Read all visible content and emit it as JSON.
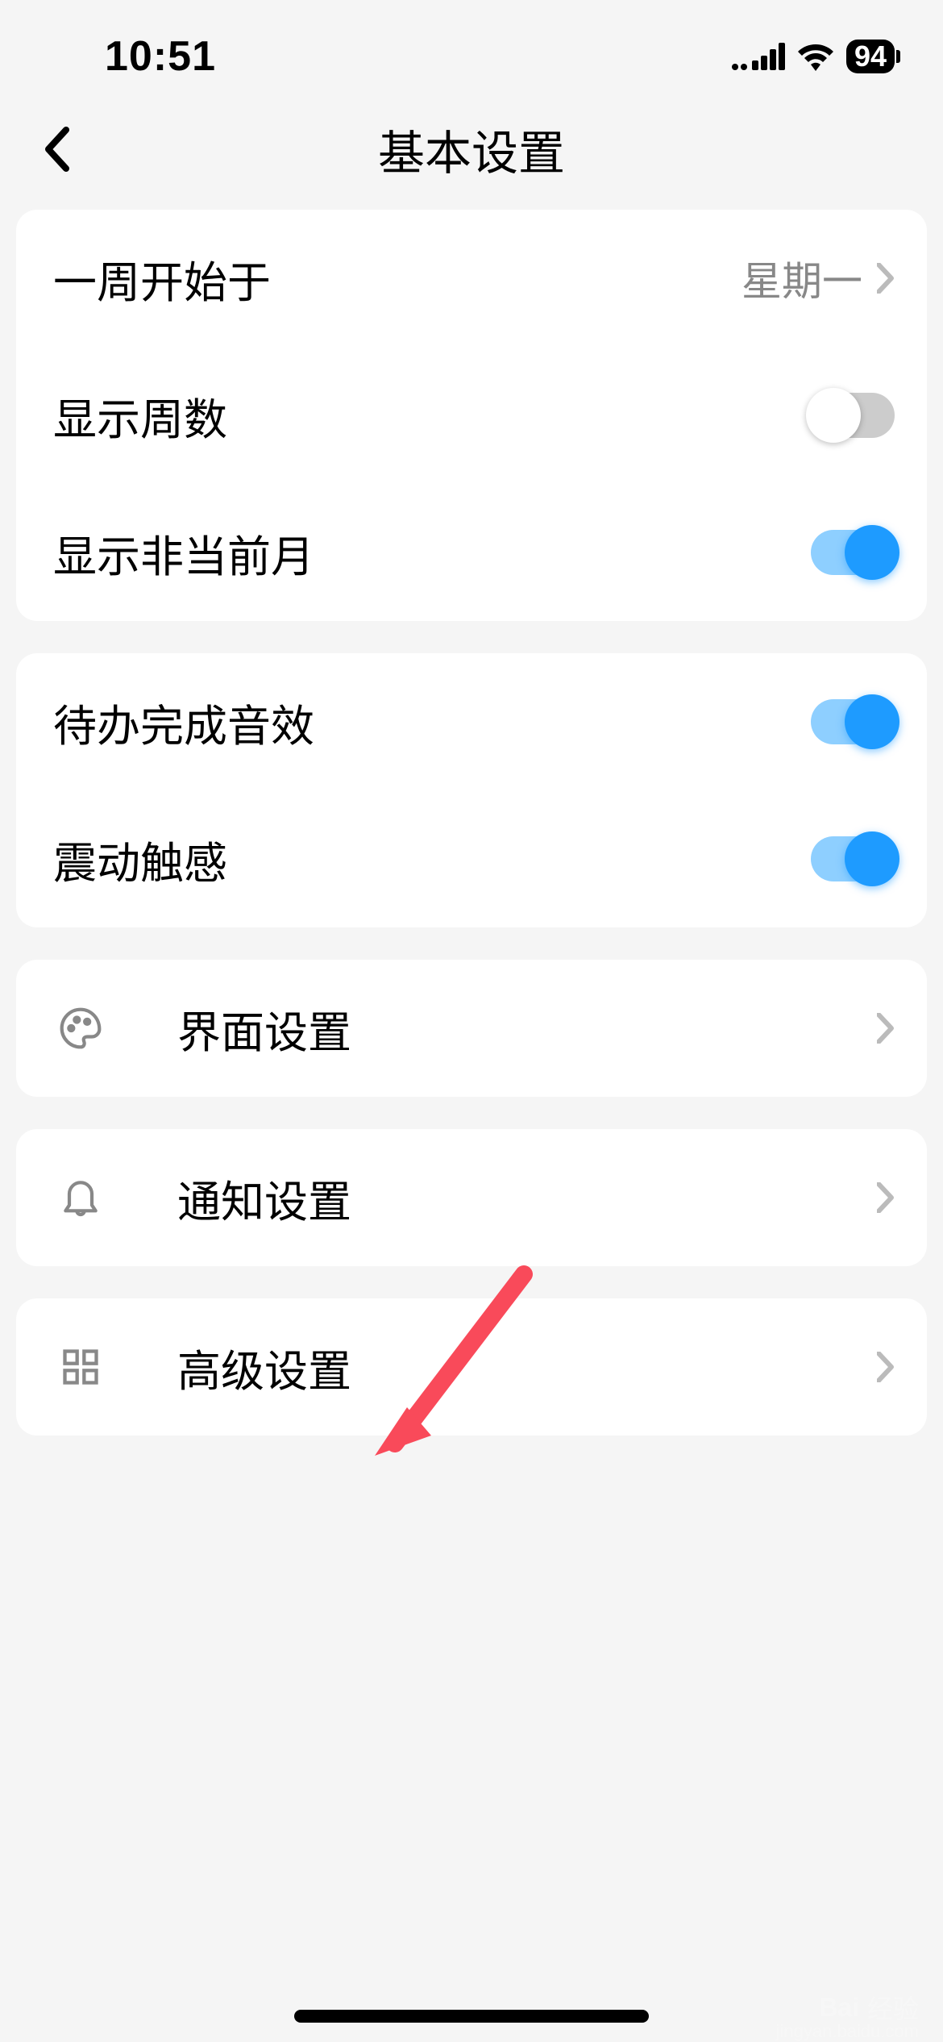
{
  "status": {
    "time": "10:51",
    "battery": "94"
  },
  "header": {
    "title": "基本设置"
  },
  "group1": {
    "week_start_label": "一周开始于",
    "week_start_value": "星期一",
    "show_week_num_label": "显示周数",
    "show_week_num_on": false,
    "show_non_current_label": "显示非当前月",
    "show_non_current_on": true
  },
  "group2": {
    "todo_sound_label": "待办完成音效",
    "todo_sound_on": true,
    "haptic_label": "震动触感",
    "haptic_on": true
  },
  "nav_rows": {
    "ui_settings": "界面设置",
    "notification_settings": "通知设置",
    "advanced_settings": "高级设置"
  },
  "watermark": {
    "brand": "Bai",
    "brand2": "经验",
    "url": "jingyan.baidu.com"
  }
}
